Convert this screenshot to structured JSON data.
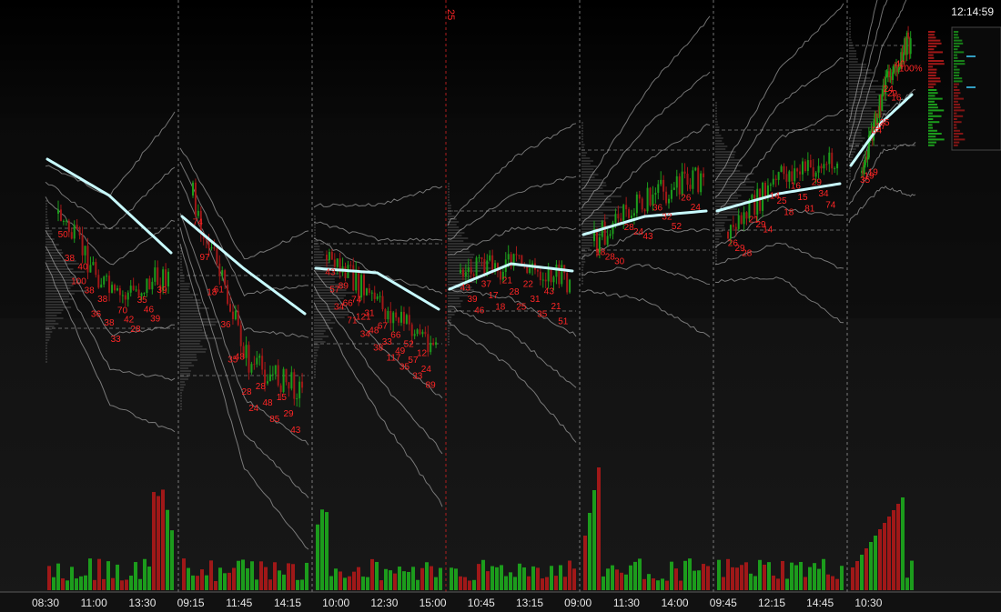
{
  "clock": "12:14:59",
  "session_marker": "25",
  "colors": {
    "up": "#1c9c1c",
    "down": "#a01818",
    "vwap": "#c8fbff",
    "band": "#bdbdbd",
    "label": "#ff2626",
    "divider": "#bfbfbf",
    "session_divider": "#c02020"
  },
  "chart_data": {
    "type": "candlestick-with-volume",
    "x_tick_labels": [
      "08:30",
      "11:00",
      "13:30",
      "09:15",
      "11:45",
      "14:15",
      "10:00",
      "12:30",
      "15:00",
      "10:45",
      "13:15",
      "09:00",
      "11:30",
      "14:00",
      "09:45",
      "12:15",
      "14:45",
      "10:30"
    ],
    "sessions": [
      {
        "labels": [
          "50",
          "38",
          "100",
          "40",
          "38",
          "36",
          "38",
          "38",
          "33",
          "70",
          "42",
          "28",
          "35",
          "46",
          "39",
          "39"
        ]
      },
      {
        "labels": [
          "74",
          "97",
          "18",
          "61",
          "36",
          "35",
          "48",
          "28",
          "24",
          "28",
          "48",
          "85",
          "15",
          "29",
          "43"
        ]
      },
      {
        "labels": [
          "43",
          "57",
          "34",
          "89",
          "66",
          "71",
          "74",
          "121",
          "34",
          "31",
          "48",
          "38",
          "67",
          "33",
          "117",
          "66",
          "49",
          "35",
          "52",
          "57",
          "33",
          "12",
          "24",
          "89"
        ]
      },
      {
        "labels": [
          "43",
          "39",
          "46",
          "37",
          "17",
          "18",
          "21",
          "28",
          "25",
          "22",
          "31",
          "35",
          "43",
          "21",
          "51"
        ]
      },
      {
        "labels": [
          "18",
          "28",
          "30",
          "28",
          "24",
          "43",
          "36",
          "32",
          "52",
          "26",
          "24"
        ]
      },
      {
        "labels": [
          "26",
          "29",
          "28",
          "21",
          "29",
          "14",
          "14",
          "25",
          "18",
          "16",
          "15",
          "81",
          "29",
          "34",
          "74"
        ]
      },
      {
        "labels": [
          "35",
          "19",
          "19",
          "34",
          "17",
          "25",
          "24",
          "29",
          "16",
          "40",
          "100%"
        ]
      }
    ],
    "volume_note": "green = up volume, red = down volume"
  }
}
